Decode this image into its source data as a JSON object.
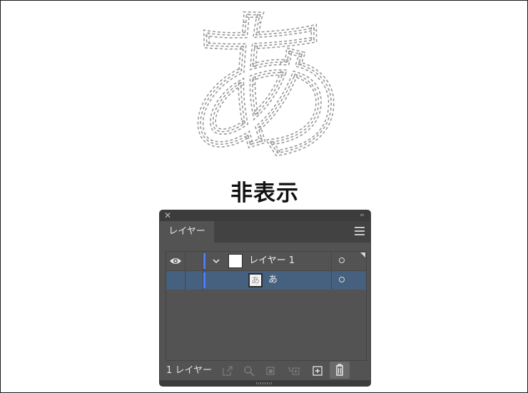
{
  "artwork": {
    "glyph": "あ",
    "caption": "非表示"
  },
  "panel": {
    "tab_label": "レイヤー",
    "layers": [
      {
        "name": "レイヤー 1",
        "visible": true,
        "expanded": true,
        "selected": false,
        "color": "#4f7bff"
      },
      {
        "name": "あ",
        "visible": false,
        "selected": true,
        "thumbnail_text": "あ",
        "color": "#4f7bff"
      }
    ],
    "footer": {
      "layer_count": "1 レイヤー"
    }
  },
  "colors": {
    "panel_bg": "#535353",
    "selected_row": "#46607f",
    "layer_color": "#4f7bff"
  }
}
